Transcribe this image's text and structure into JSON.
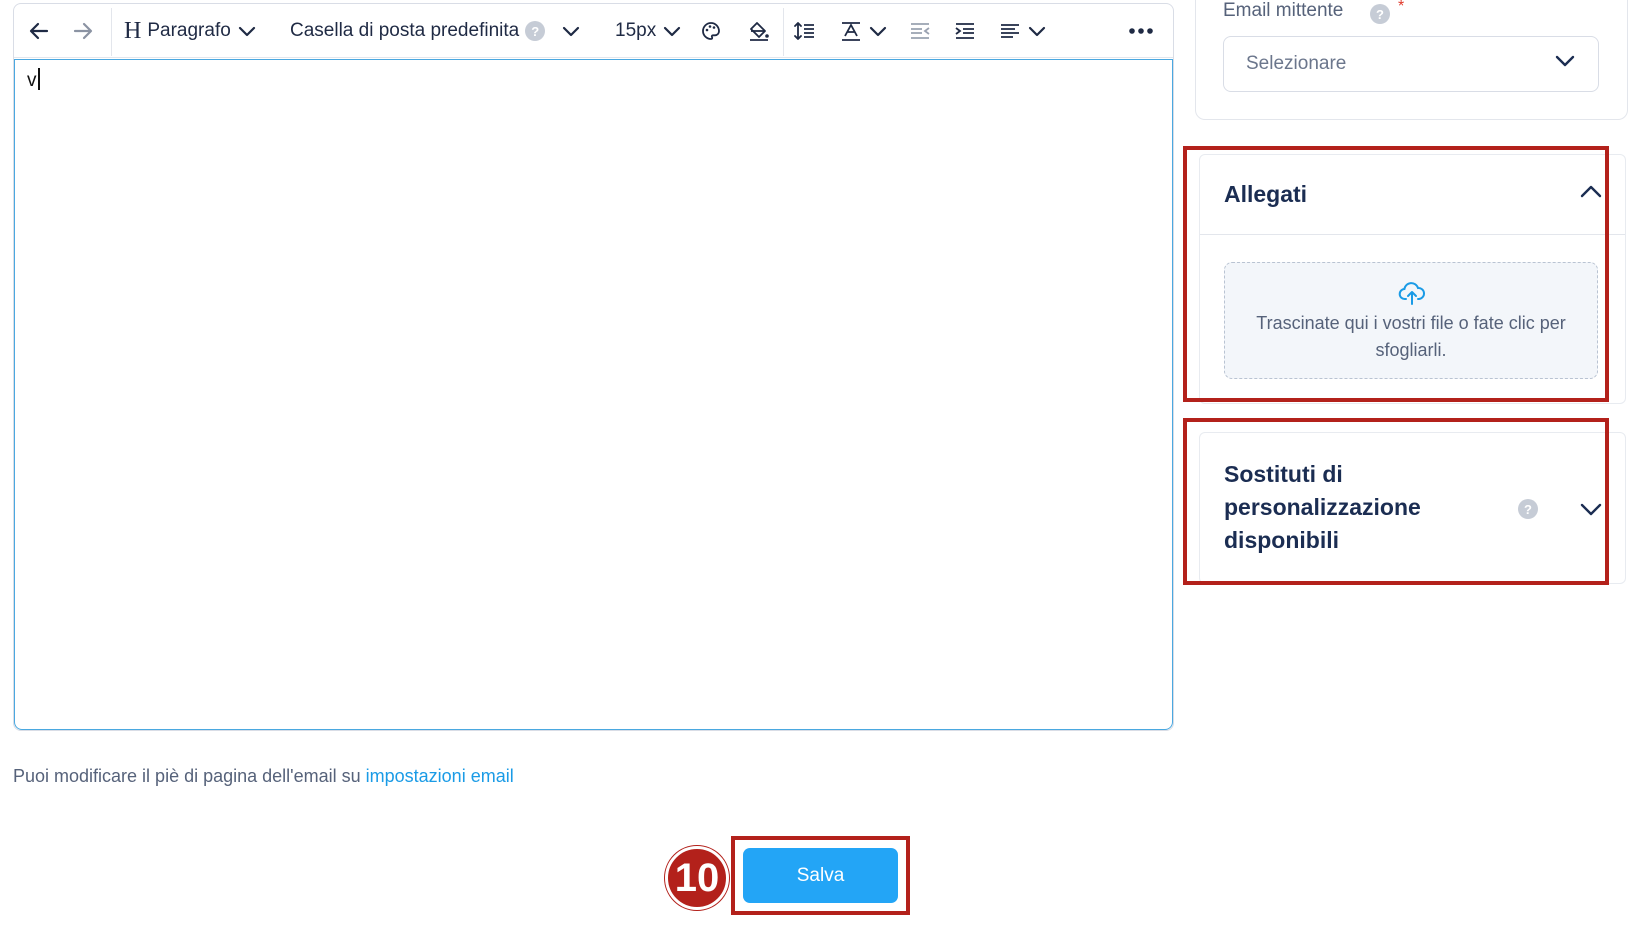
{
  "editor": {
    "toolbar": {
      "block_format": "Paragrafo",
      "font_family": "Casella di posta predefinita",
      "font_size": "15px"
    },
    "content": "v"
  },
  "footer": {
    "note_prefix": "Puoi modificare il piè di pagina dell'email su ",
    "note_link": "impostazioni email"
  },
  "save": {
    "step_number": "10",
    "label": "Salva"
  },
  "sender": {
    "label": "Email mittente",
    "required_mark": "*",
    "placeholder": "Selezionare"
  },
  "attachments": {
    "title": "Allegati",
    "dropzone_text": "Trascinate qui i vostri file o fate clic per sfogliarli."
  },
  "personalization": {
    "title": "Sostituti di personalizzazione disponibili"
  },
  "colors": {
    "accent": "#23a5f6",
    "highlight": "#b3211b",
    "heading": "#1b2d52"
  }
}
